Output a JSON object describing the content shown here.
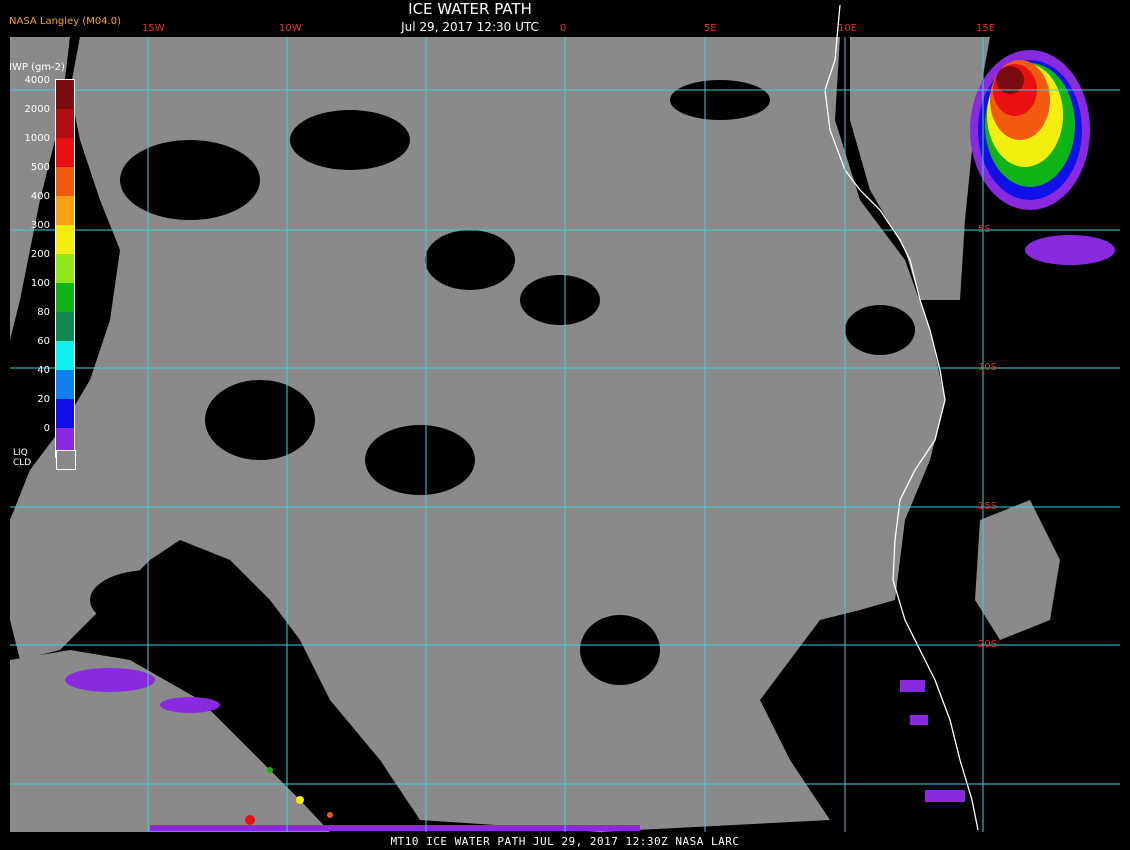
{
  "header": {
    "title": "ICE WATER PATH",
    "subtitle": "Jul 29, 2017 12:30 UTC",
    "credit": "NASA Langley (M04.0)"
  },
  "footer": {
    "caption": "MT10  ICE WATER PATH  JUL 29, 2017 12:30Z  NASA LARC"
  },
  "legend": {
    "title": "IWP (gm-2)",
    "levels": [
      {
        "label": "4000",
        "color": "#7a0c10"
      },
      {
        "label": "2000",
        "color": "#b01010"
      },
      {
        "label": "1000",
        "color": "#e81010"
      },
      {
        "label": "500",
        "color": "#f25a10"
      },
      {
        "label": "400",
        "color": "#f7a010"
      },
      {
        "label": "300",
        "color": "#f2ee10"
      },
      {
        "label": "200",
        "color": "#8ee81a"
      },
      {
        "label": "100",
        "color": "#10b418"
      },
      {
        "label": "80",
        "color": "#108a50"
      },
      {
        "label": "60",
        "color": "#10f2f2"
      },
      {
        "label": "40",
        "color": "#1080f0"
      },
      {
        "label": "20",
        "color": "#1010e8"
      },
      {
        "label": "0",
        "color": "#8a2ae0"
      }
    ],
    "liquid_cloud": {
      "label_line1": "LIQ",
      "label_line2": "CLD",
      "color": "#8a8a8a"
    }
  },
  "map": {
    "longitude_labels": [
      "15W",
      "10W",
      "0",
      "5E",
      "10E",
      "15E"
    ],
    "latitude_labels": [
      "5S",
      "10S",
      "15S",
      "20S"
    ],
    "grid_color": "#3fd0d8",
    "label_color": "#e0302a",
    "coastline_color": "#ffffff",
    "background_color": "#000000",
    "cloud_gray": "#8a8a8a"
  }
}
